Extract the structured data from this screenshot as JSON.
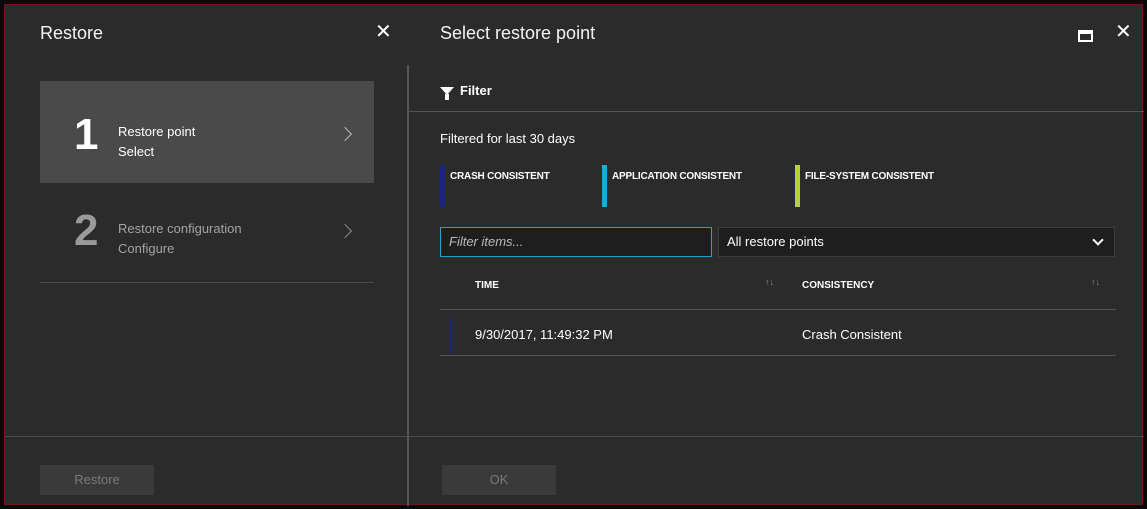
{
  "left_blade": {
    "title": "Restore",
    "steps": [
      {
        "number": "1",
        "title": "Restore point",
        "subtitle": "Select"
      },
      {
        "number": "2",
        "title": "Restore configuration",
        "subtitle": "Configure"
      }
    ],
    "restore_button": "Restore"
  },
  "right_blade": {
    "title": "Select restore point",
    "filter_label": "Filter",
    "filtered_note": "Filtered for last 30 days",
    "legend": [
      {
        "label": "CRASH CONSISTENT",
        "color": "#1a237e"
      },
      {
        "label": "APPLICATION CONSISTENT",
        "color": "#1ea7d8"
      },
      {
        "label": "FILE-SYSTEM CONSISTENT",
        "color": "#b5d334"
      }
    ],
    "filter_input_placeholder": "Filter items...",
    "select_value": "All restore points",
    "columns": [
      "TIME",
      "CONSISTENCY"
    ],
    "rows": [
      {
        "time": "9/30/2017, 11:49:32 PM",
        "consistency": "Crash Consistent"
      }
    ],
    "ok_button": "OK"
  },
  "icons": {
    "close": "✕",
    "sort": "↑↓"
  }
}
